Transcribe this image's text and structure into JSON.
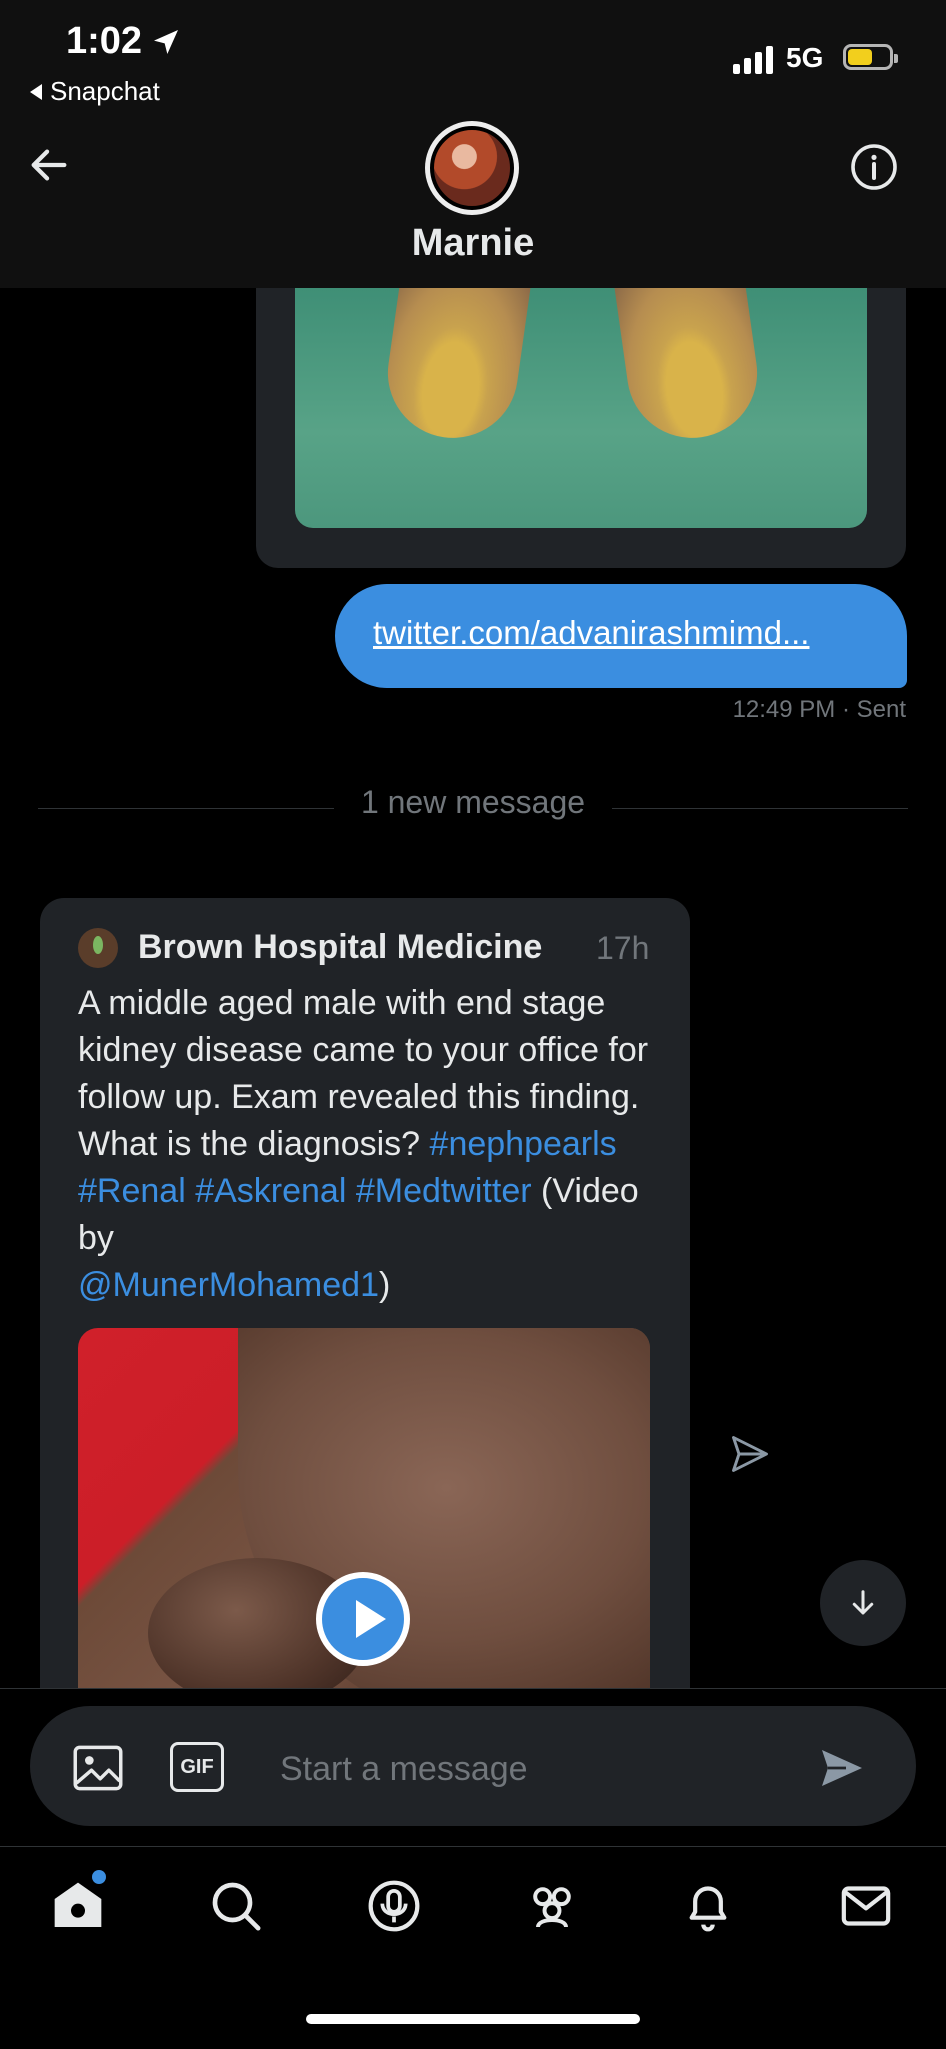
{
  "status_bar": {
    "time": "1:02",
    "back_app": "Snapchat",
    "network": "5G"
  },
  "header": {
    "contact_name": "Marnie"
  },
  "conversation": {
    "sent_link": "twitter.com/advanirashmimd...",
    "sent_time": "12:49 PM",
    "sent_status": "· Sent",
    "divider_label": "1 new message",
    "received_tweet": {
      "author": "Brown Hospital Medicine",
      "age": "17h",
      "text_1": "A middle aged male with end stage kidney disease came to your office for follow up. Exam revealed this finding. What is the diagnosis?",
      "hashtag_1": "#nephpearls",
      "hashtag_2": "#Renal",
      "hashtag_3": "#Askrenal",
      "hashtag_4": "#Medtwitter",
      "text_2": "(Video by",
      "mention": "@MunerMohamed1",
      "text_3": ")"
    }
  },
  "composer": {
    "gif_label": "GIF",
    "placeholder": "Start a message"
  },
  "nav": {
    "items": [
      "home-icon",
      "search-icon",
      "spaces-icon",
      "communities-icon",
      "notifications-icon",
      "messages-icon"
    ]
  },
  "colors": {
    "accent": "#3b8ee0",
    "card": "#202327",
    "background": "#000000"
  }
}
